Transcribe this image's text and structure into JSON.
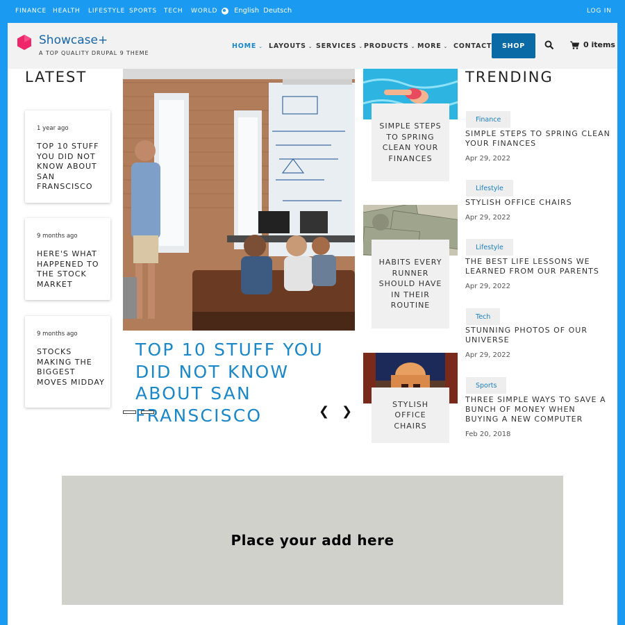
{
  "topbar": {
    "links": [
      "FINANCE",
      "HEALTH",
      "LIFESTYLE",
      "SPORTS",
      "TECH",
      "WORLD"
    ],
    "lang_en": "English",
    "lang_de": "Deutsch",
    "login": "LOG IN"
  },
  "header": {
    "brand": "Showcase+",
    "tagline": "A TOP QUALITY DRUPAL 9 THEME",
    "nav": [
      "HOME",
      "LAYOUTS",
      "SERVICES",
      "PRODUCTS",
      "MORE",
      "CONTACT"
    ],
    "shop": "SHOP",
    "cart": "0 items"
  },
  "colors": {
    "accent": "#1a9af0",
    "link": "#1a87c9",
    "shop": "#0a6aa6"
  },
  "latest": {
    "title": "LATEST",
    "items": [
      {
        "time": "1 year ago",
        "title": "TOP 10 STUFF YOU DID NOT KNOW ABOUT SAN FRANSCISCO"
      },
      {
        "time": "9 months ago",
        "title": "HERE'S WHAT HAPPENED TO THE STOCK MARKET"
      },
      {
        "time": "9 months ago",
        "title": "STOCKS MAKING THE BIGGEST MOVES MIDDAY"
      }
    ]
  },
  "hero": {
    "title": "TOP 10 STUFF YOU DID NOT KNOW ABOUT SAN FRANSCISCO"
  },
  "middle": [
    {
      "title": "SIMPLE STEPS TO SPRING CLEAN YOUR FINANCES"
    },
    {
      "title": "HABITS EVERY RUNNER SHOULD HAVE IN THEIR ROUTINE"
    },
    {
      "title": "STYLISH OFFICE CHAIRS"
    }
  ],
  "trending": {
    "title": "TRENDING",
    "items": [
      {
        "category": "Finance",
        "title": "SIMPLE STEPS TO SPRING CLEAN YOUR FINANCES",
        "date": "Apr 29, 2022"
      },
      {
        "category": "Lifestyle",
        "title": "STYLISH OFFICE CHAIRS",
        "date": "Apr 29, 2022"
      },
      {
        "category": "Lifestyle",
        "title": "THE BEST LIFE LESSONS WE LEARNED FROM OUR PARENTS",
        "date": "Apr 29, 2022"
      },
      {
        "category": "Tech",
        "title": "STUNNING PHOTOS OF OUR UNIVERSE",
        "date": "Apr 29, 2022"
      },
      {
        "category": "Sports",
        "title": "THREE SIMPLE WAYS TO SAVE A BUNCH OF MONEY WHEN BUYING A NEW COMPUTER",
        "date": "Feb 20, 2018"
      }
    ]
  },
  "ad": {
    "text": "Place your add here"
  }
}
